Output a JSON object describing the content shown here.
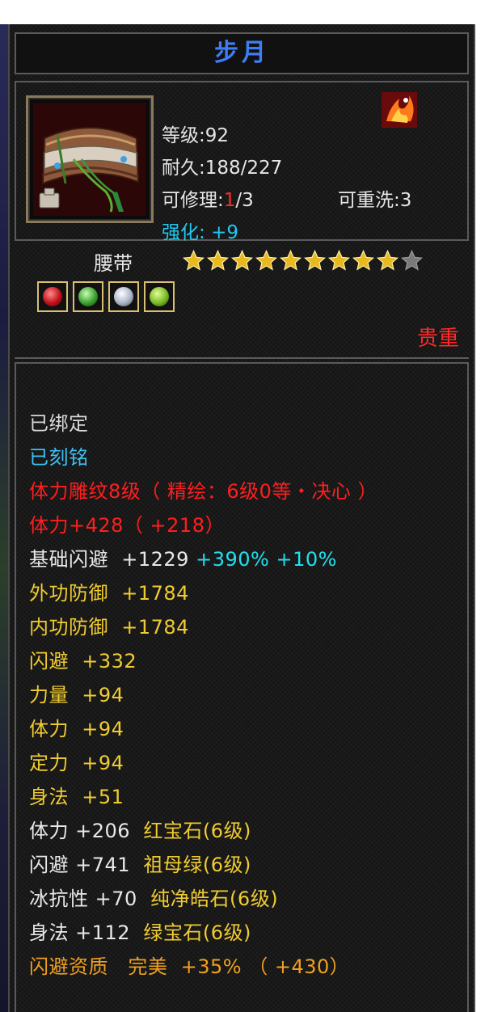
{
  "item": {
    "name": "步月",
    "level": "等级:92",
    "durability": "耐久:188/227",
    "repair_prefix": "可修理:",
    "repair_used": "1",
    "repair_total": "/3",
    "rewash": "可重洗:3",
    "enhance_label": "强化:",
    "enhance_value": "+9",
    "type": "腰带",
    "stars_filled": 9,
    "stars_total": 10,
    "rarity": "贵重",
    "gems": [
      "red-gem",
      "green-gem",
      "white-gem",
      "jade-gem"
    ]
  },
  "attributes": {
    "bound": "已绑定",
    "engraved": "已刻铭",
    "carve": "体力雕纹8级（ 精绘：6级0等・决心 ）",
    "stamina_total": "体力+428（ +218）",
    "base_dodge_label": "基础闪避",
    "base_dodge_value": "+1229",
    "base_dodge_pct1": "+390%",
    "base_dodge_pct2": "+10%",
    "rows": [
      {
        "label": "外功防御",
        "value": "+1784"
      },
      {
        "label": "内功防御",
        "value": "+1784"
      },
      {
        "label": "闪避",
        "value": "+332"
      },
      {
        "label": "力量",
        "value": "+94"
      },
      {
        "label": "体力",
        "value": "+94"
      },
      {
        "label": "定力",
        "value": "+94"
      },
      {
        "label": "身法",
        "value": "+51"
      }
    ],
    "gem_rows": [
      {
        "label": "体力",
        "value": "+206",
        "gem": "红宝石(6级)"
      },
      {
        "label": "闪避",
        "value": "+741",
        "gem": "祖母绿(6级)"
      },
      {
        "label": "冰抗性",
        "value": "+70",
        "gem": "纯净皓石(6级)"
      },
      {
        "label": "身法",
        "value": "+112",
        "gem": "绿宝石(6级)"
      }
    ],
    "aptitude_label": "闪避资质",
    "aptitude_grade": "完美",
    "aptitude_value": "+35% （ +430）"
  },
  "colors": {
    "title": "#3f7df7",
    "rarity": "#ff2a2a",
    "stat_gold": "#f0cc30",
    "aptitude": "#f0a020"
  }
}
